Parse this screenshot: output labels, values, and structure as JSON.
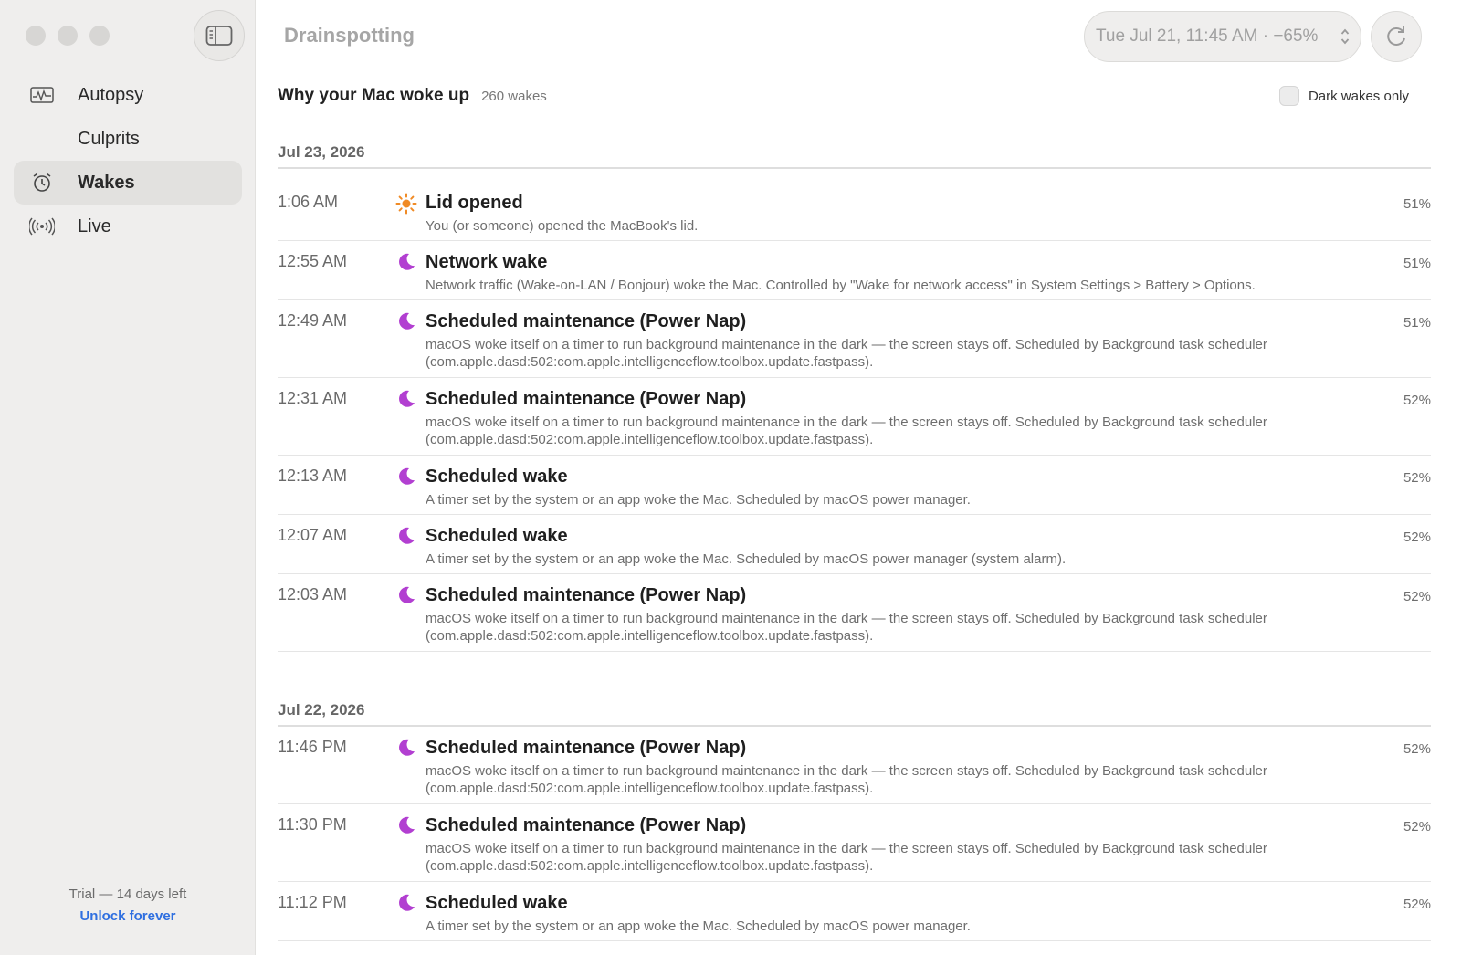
{
  "app": {
    "title": "Drainspotting",
    "date_selector": "Tue Jul 21, 11:45 AM · −65%"
  },
  "sidebar": {
    "items": [
      {
        "label": "Autopsy",
        "icon": "activity-chart-icon",
        "active": false
      },
      {
        "label": "Culprits",
        "icon": "",
        "active": false
      },
      {
        "label": "Wakes",
        "icon": "alarm-clock-icon",
        "active": true
      },
      {
        "label": "Live",
        "icon": "broadcast-icon",
        "active": false
      }
    ],
    "trial_text": "Trial — 14 days left",
    "unlock_label": "Unlock forever"
  },
  "header": {
    "title": "Why your Mac woke up",
    "count": "260 wakes",
    "dark_wakes_label": "Dark wakes only"
  },
  "groups": [
    {
      "date": "Jul 23, 2026",
      "rows": [
        {
          "time": "1:06 AM",
          "type": "sun",
          "title": "Lid opened",
          "desc": "You (or someone) opened the MacBook's lid.",
          "pct": "51%"
        },
        {
          "time": "12:55 AM",
          "type": "moon",
          "title": "Network wake",
          "desc": "Network traffic (Wake-on-LAN / Bonjour) woke the Mac. Controlled by \"Wake for network access\" in System Settings > Battery > Options.",
          "pct": "51%"
        },
        {
          "time": "12:49 AM",
          "type": "moon",
          "title": "Scheduled maintenance (Power Nap)",
          "desc": "macOS woke itself on a timer to run background maintenance in the dark — the screen stays off. Scheduled by Background task scheduler (com.apple.dasd:502:com.apple.intelligenceflow.toolbox.update.fastpass).",
          "pct": "51%"
        },
        {
          "time": "12:31 AM",
          "type": "moon",
          "title": "Scheduled maintenance (Power Nap)",
          "desc": "macOS woke itself on a timer to run background maintenance in the dark — the screen stays off. Scheduled by Background task scheduler (com.apple.dasd:502:com.apple.intelligenceflow.toolbox.update.fastpass).",
          "pct": "52%"
        },
        {
          "time": "12:13 AM",
          "type": "moon",
          "title": "Scheduled wake",
          "desc": "A timer set by the system or an app woke the Mac. Scheduled by macOS power manager.",
          "pct": "52%"
        },
        {
          "time": "12:07 AM",
          "type": "moon",
          "title": "Scheduled wake",
          "desc": "A timer set by the system or an app woke the Mac. Scheduled by macOS power manager (system alarm).",
          "pct": "52%"
        },
        {
          "time": "12:03 AM",
          "type": "moon",
          "title": "Scheduled maintenance (Power Nap)",
          "desc": "macOS woke itself on a timer to run background maintenance in the dark — the screen stays off. Scheduled by Background task scheduler (com.apple.dasd:502:com.apple.intelligenceflow.toolbox.update.fastpass).",
          "pct": "52%"
        }
      ]
    },
    {
      "date": "Jul 22, 2026",
      "rows": [
        {
          "time": "11:46 PM",
          "type": "moon",
          "title": "Scheduled maintenance (Power Nap)",
          "desc": "macOS woke itself on a timer to run background maintenance in the dark — the screen stays off. Scheduled by Background task scheduler (com.apple.dasd:502:com.apple.intelligenceflow.toolbox.update.fastpass).",
          "pct": "52%"
        },
        {
          "time": "11:30 PM",
          "type": "moon",
          "title": "Scheduled maintenance (Power Nap)",
          "desc": "macOS woke itself on a timer to run background maintenance in the dark — the screen stays off. Scheduled by Background task scheduler (com.apple.dasd:502:com.apple.intelligenceflow.toolbox.update.fastpass).",
          "pct": "52%"
        },
        {
          "time": "11:12 PM",
          "type": "moon",
          "title": "Scheduled wake",
          "desc": "A timer set by the system or an app woke the Mac. Scheduled by macOS power manager.",
          "pct": "52%"
        }
      ]
    }
  ],
  "colors": {
    "moon": "#b23fd1",
    "sun": "#f08a24",
    "accent_link": "#2f6fe0"
  }
}
